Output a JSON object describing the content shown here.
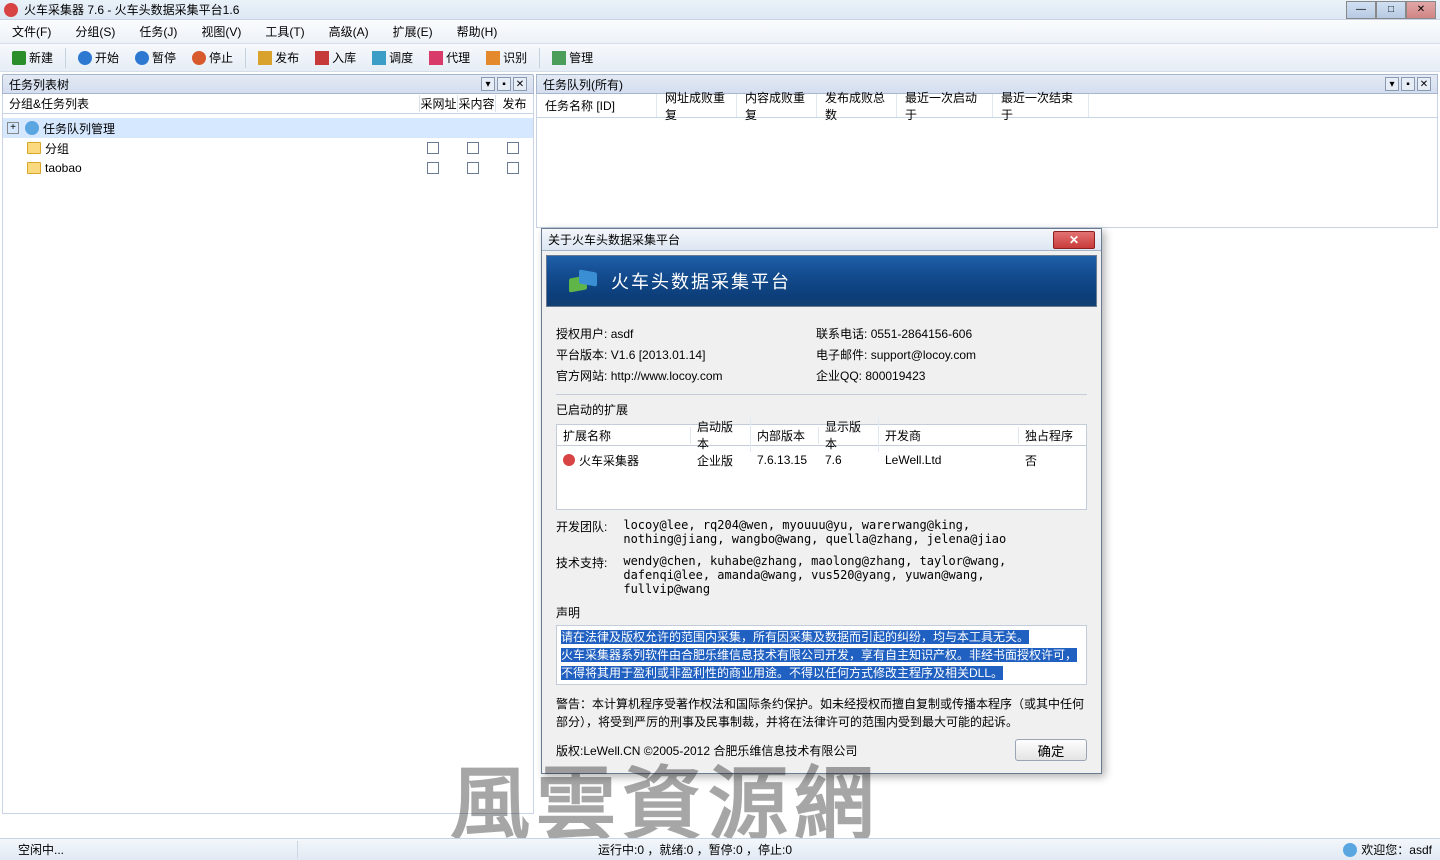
{
  "title": "火车采集器 7.6 - 火车头数据采集平台1.6",
  "menu": [
    "文件(F)",
    "分组(S)",
    "任务(J)",
    "视图(V)",
    "工具(T)",
    "高级(A)",
    "扩展(E)",
    "帮助(H)"
  ],
  "toolbar": {
    "new": "新建",
    "start": "开始",
    "pause": "暂停",
    "stop": "停止",
    "publish": "发布",
    "store": "入库",
    "schedule": "调度",
    "proxy": "代理",
    "identify": "识别",
    "manage": "管理"
  },
  "left_pane": {
    "title": "任务列表树",
    "tab": "分组&任务列表",
    "cols": {
      "url": "采网址",
      "content": "采内容",
      "publish": "发布"
    },
    "tree_root": "任务队列管理",
    "items": [
      "分组",
      "taobao"
    ]
  },
  "right_pane": {
    "title": "任务队列(所有)",
    "cols": [
      "任务名称 [ID]",
      "网址成败重复",
      "内容成败重复",
      "发布成败总数",
      "最近一次启动于",
      "最近一次结束于"
    ]
  },
  "dialog": {
    "title": "关于火车头数据采集平台",
    "banner": "火车头数据采集平台",
    "info": {
      "user_label": "授权用户:",
      "user": "asdf",
      "phone_label": "联系电话:",
      "phone": "0551-2864156-606",
      "ver_label": "平台版本:",
      "ver": "V1.6 [2013.01.14]",
      "email_label": "电子邮件:",
      "email": "support@locoy.com",
      "site_label": "官方网站:",
      "site": "http://www.locoy.com",
      "qq_label": "企业QQ:",
      "qq": "800019423"
    },
    "ext_section": "已启动的扩展",
    "ext_cols": [
      "扩展名称",
      "启动版本",
      "内部版本",
      "显示版本",
      "开发商",
      "独占程序"
    ],
    "ext_row": {
      "name": "火车采集器",
      "launch": "企业版",
      "internal": "7.6.13.15",
      "display": "7.6",
      "dev": "LeWell.Ltd",
      "excl": "否"
    },
    "dev_team_label": "开发团队:",
    "dev_team": "locoy@lee, rq204@wen, myouuu@yu, warerwang@king, nothing@jiang, wangbo@wang, quella@zhang, jelena@jiao",
    "support_label": "技术支持:",
    "support": "wendy@chen, kuhabe@zhang, maolong@zhang, taylor@wang, dafenqi@lee, amanda@wang, vus520@yang, yuwan@wang, fullvip@wang",
    "statement_label": "声明",
    "legal1": "请在法律及版权允许的范围内采集，所有因采集及数据而引起的纠纷，均与本工具无关。",
    "legal2": "火车采集器系列软件由合肥乐维信息技术有限公司开发，享有自主知识产权。非经书面授权许可，不得将其用于盈利或非盈利性的商业用途。不得以任何方式修改主程序及相关DLL。",
    "warn": "警告：本计算机程序受著作权法和国际条约保护。如未经授权而擅自复制或传播本程序（或其中任何部分），将受到严厉的刑事及民事制裁，并将在法律许可的范围内受到最大可能的起诉。",
    "copyright": "版权:LeWell.CN ©2005-2012 合肥乐维信息技术有限公司",
    "ok": "确定"
  },
  "status": {
    "idle": "空闲中...",
    "running": "运行中:0 ，就绪:0 ，暂停:0 ，停止:0",
    "welcome": "欢迎您：asdf"
  },
  "watermark": "風雲資源網"
}
